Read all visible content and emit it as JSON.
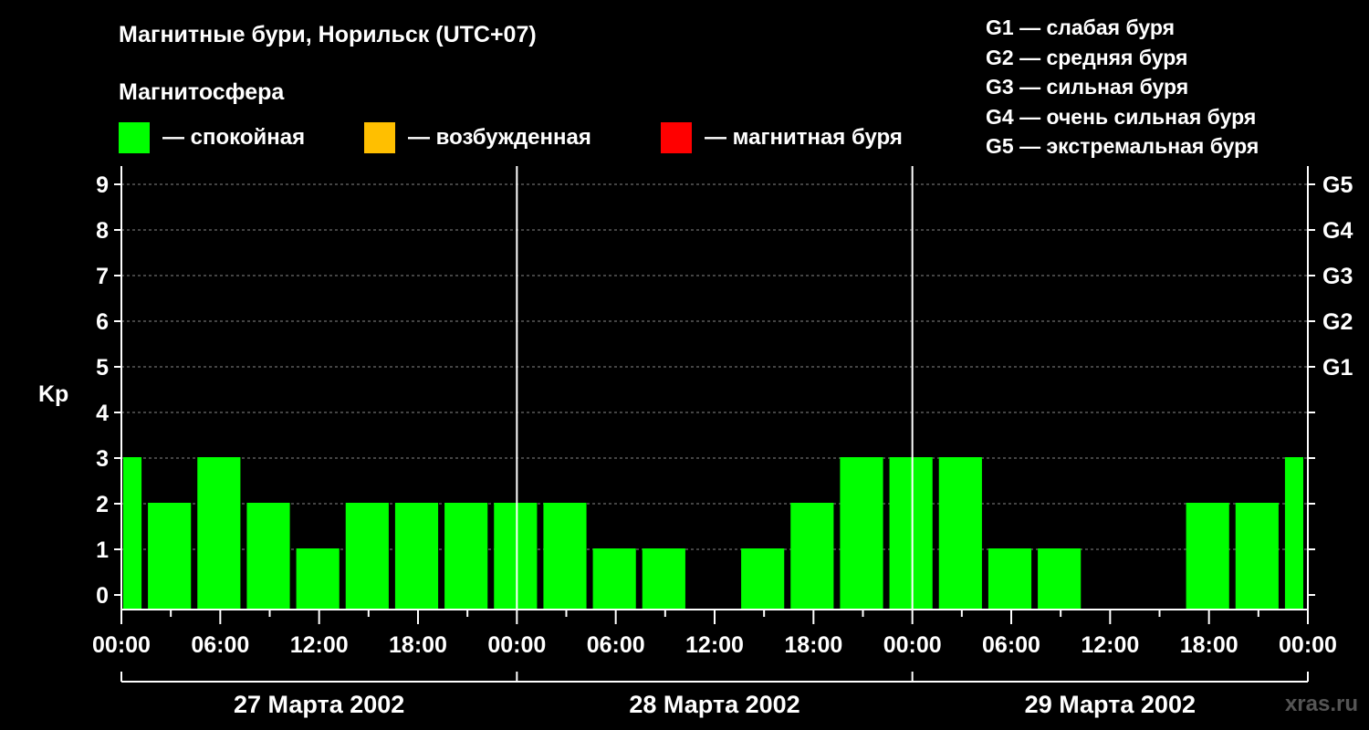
{
  "title": "Магнитные бури, Норильск (UTC+07)",
  "subtitle": "Магнитосфера",
  "colors": {
    "background": "#000000",
    "quiet": "#00ff00",
    "excited": "#ffbf00",
    "storm": "#ff0000",
    "axis": "#ffffff",
    "grid": "#888888"
  },
  "legend": [
    {
      "label": "— спокойная",
      "color": "#00ff00"
    },
    {
      "label": "— возбужденная",
      "color": "#ffbf00"
    },
    {
      "label": "— магнитная буря",
      "color": "#ff0000"
    }
  ],
  "g_legend": [
    "G1 — слабая буря",
    "G2 — средняя буря",
    "G3 — сильная буря",
    "G4 — очень сильная буря",
    "G5 — экстремальная буря"
  ],
  "watermark": "xras.ru",
  "chart_data": {
    "type": "bar",
    "ylabel": "Kp",
    "ylim": [
      0,
      9
    ],
    "y_ticks": [
      "0",
      "1",
      "2",
      "3",
      "4",
      "5",
      "6",
      "7",
      "8",
      "9"
    ],
    "right_ticks": [
      {
        "value": 5,
        "label": "G1"
      },
      {
        "value": 6,
        "label": "G2"
      },
      {
        "value": 7,
        "label": "G3"
      },
      {
        "value": 8,
        "label": "G4"
      },
      {
        "value": 9,
        "label": "G5"
      }
    ],
    "x_tick_labels": [
      "00:00",
      "06:00",
      "12:00",
      "18:00",
      "00:00",
      "06:00",
      "12:00",
      "18:00",
      "00:00",
      "06:00",
      "12:00",
      "18:00",
      "00:00"
    ],
    "days": [
      "27 Марта 2002",
      "28 Марта 2002",
      "29 Марта 2002"
    ],
    "grid": "dashed horizontal",
    "series": [
      {
        "values": [
          3,
          2,
          3,
          2,
          1,
          2,
          2,
          2,
          2,
          2,
          1,
          1,
          0,
          1,
          2,
          3,
          3,
          3,
          1,
          1,
          0,
          0,
          2,
          2,
          3
        ]
      }
    ]
  }
}
